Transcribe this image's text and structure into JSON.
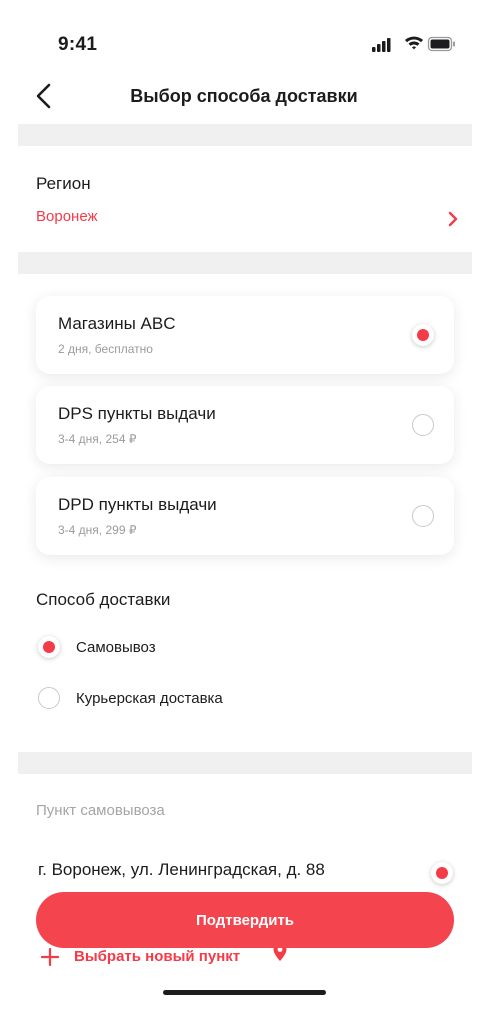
{
  "status_bar": {
    "time": "9:41"
  },
  "header": {
    "title": "Выбор способа доставки"
  },
  "region": {
    "label": "Регион",
    "value": "Воронеж"
  },
  "delivery_services": [
    {
      "name": "Магазины ABC",
      "details": "2 дня, бесплатно",
      "selected": true
    },
    {
      "name": "DPS пункты выдачи",
      "details": "3-4 дня, 254 ₽",
      "selected": false
    },
    {
      "name": "DPD пункты выдачи",
      "details": "3-4 дня, 299 ₽",
      "selected": false
    }
  ],
  "delivery_method": {
    "title": "Способ доставки",
    "options": [
      {
        "label": "Самовывоз",
        "selected": true
      },
      {
        "label": "Курьерская доставка",
        "selected": false
      }
    ]
  },
  "pickup": {
    "label": "Пункт самовывоза",
    "address": "г. Воронеж, ул. Ленинградская, д. 88",
    "add_new_label": "Выбрать новый пункт"
  },
  "confirm_button": {
    "label": "Подтвердить"
  },
  "colors": {
    "accent": "#f43b48",
    "muted": "#9b9b9f",
    "band": "#f0f0f1"
  }
}
